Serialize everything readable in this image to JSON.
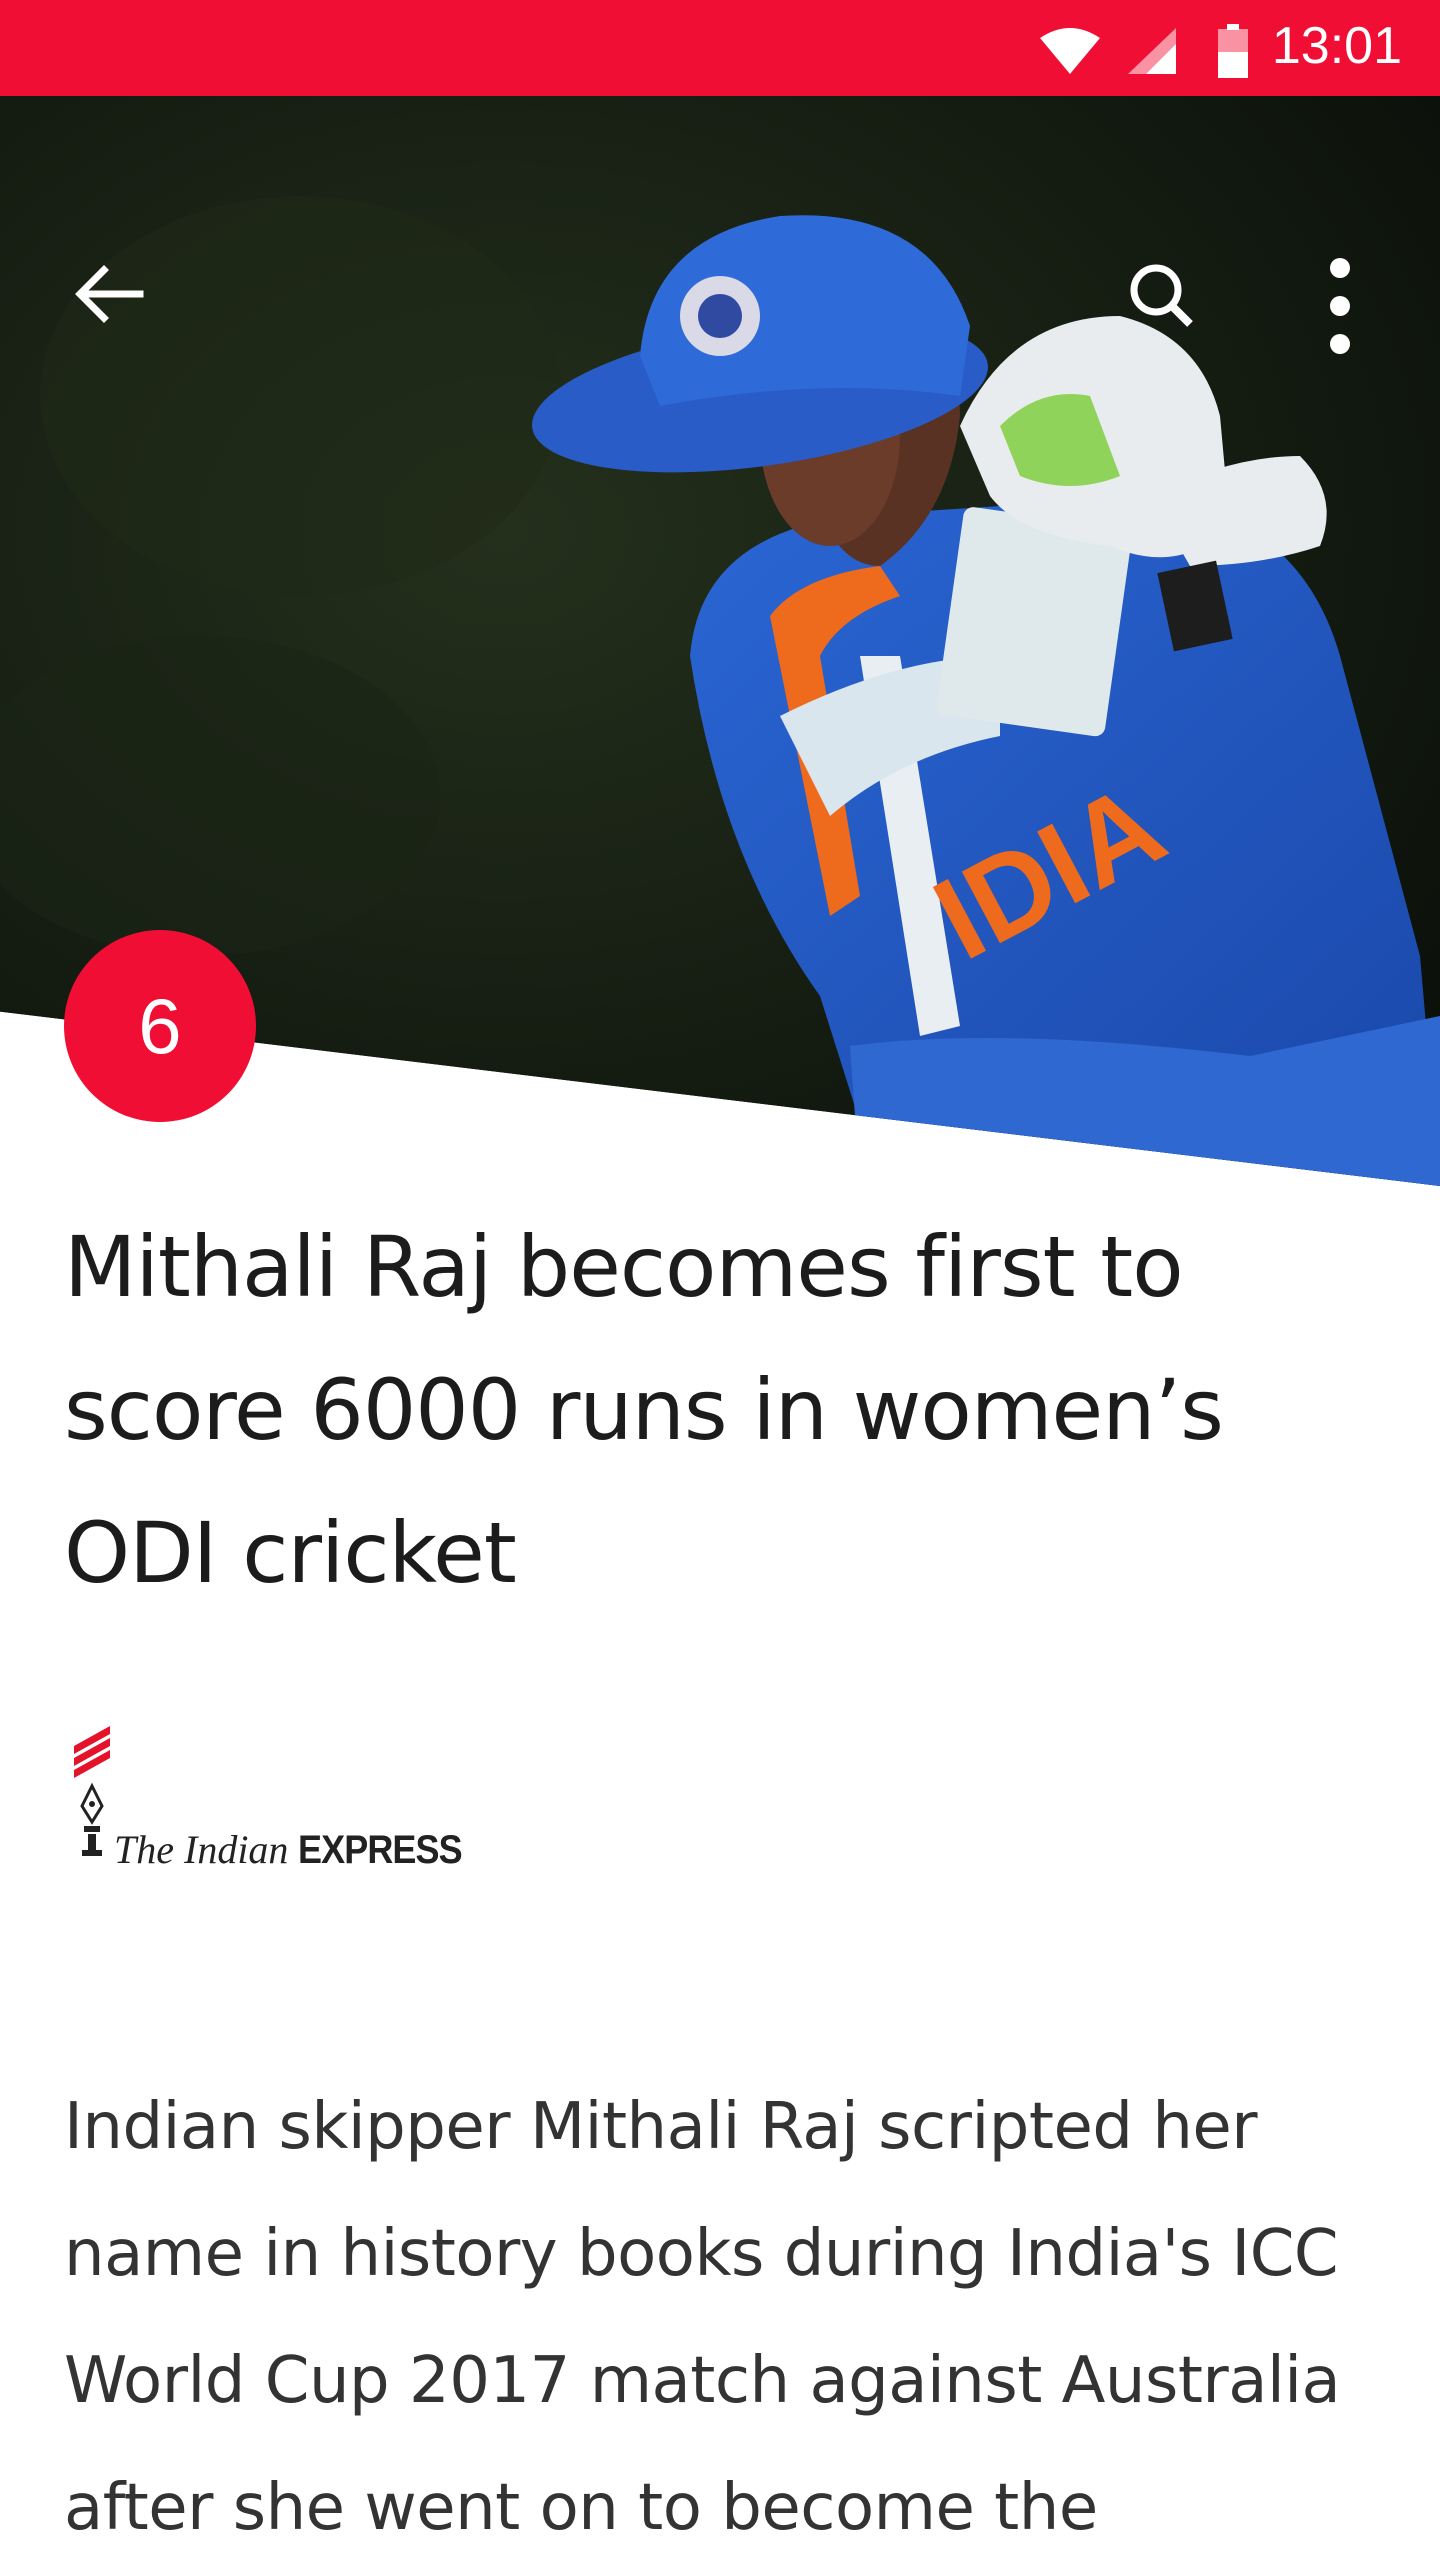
{
  "status_bar": {
    "time": "13:01",
    "wifi_icon": "wifi-icon",
    "signal_icon": "cell-signal-icon",
    "battery_icon": "battery-icon"
  },
  "toolbar": {
    "back_icon": "arrow-back-icon",
    "search_icon": "search-icon",
    "more_icon": "more-vert-icon"
  },
  "hero": {
    "image": "cricket-batter-photo",
    "jersey_text": "IDIA"
  },
  "story": {
    "rank": "6",
    "title": "Mithali Raj becomes first to score 6000 runs in women’s ODI cricket",
    "source": {
      "name_prefix": "The Indian ",
      "name_suffix": "EXPRESS"
    },
    "body": "Indian skipper Mithali Raj scripted her name in history books during India's ICC World Cup 2017 match against Australia after she went on to become the"
  },
  "colors": {
    "accent": "#f10e34",
    "title_text": "#1c1c1c",
    "body_text": "#333333"
  }
}
